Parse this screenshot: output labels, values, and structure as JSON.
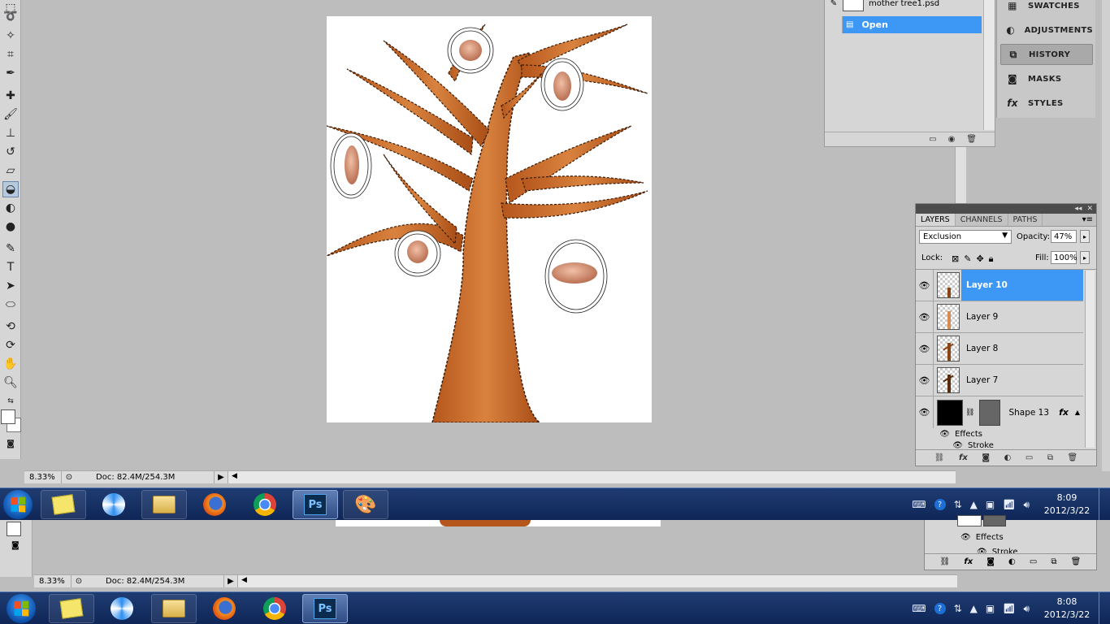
{
  "status_bar": {
    "zoom": "8.33%",
    "doc_info": "Doc: 82.4M/254.3M"
  },
  "status_bar_lower": {
    "zoom": "8.33%",
    "doc_info": "Doc: 82.4M/254.3M"
  },
  "history": {
    "snapshot_name": "mother tree1.psd",
    "items": [
      {
        "label": "Open",
        "selected": true
      }
    ]
  },
  "dock": {
    "items": [
      {
        "label": "SWATCHES",
        "icon": "swatches-icon"
      },
      {
        "label": "ADJUSTMENTS",
        "icon": "adjustments-icon"
      },
      {
        "label": "HISTORY",
        "icon": "history-icon",
        "active": true
      },
      {
        "label": "MASKS",
        "icon": "masks-icon"
      },
      {
        "label": "STYLES",
        "icon": "styles-icon"
      }
    ]
  },
  "layers_panel": {
    "tabs": [
      {
        "label": "LAYERS",
        "active": true
      },
      {
        "label": "CHANNELS"
      },
      {
        "label": "PATHS"
      }
    ],
    "blend_mode": "Exclusion",
    "opacity_label": "Opacity:",
    "opacity": "47%",
    "lock_label": "Lock:",
    "fill_label": "Fill:",
    "fill": "100%",
    "layers": [
      {
        "name": "Layer 10",
        "selected": true
      },
      {
        "name": "Layer 9"
      },
      {
        "name": "Layer 8"
      },
      {
        "name": "Layer 7"
      },
      {
        "name": "Shape 13",
        "fx": "fx"
      }
    ],
    "effects_label": "Effects",
    "stroke_label": "Stroke"
  },
  "lower_layers": {
    "effects_label": "Effects",
    "stroke_label": "Stroke"
  },
  "taskbar": {
    "time": "8:09",
    "date": "2012/3/22",
    "apps": [
      {
        "name": "sticky-notes",
        "icon": "sticky-notes-icon"
      },
      {
        "name": "media-center",
        "icon": "media-center-icon"
      },
      {
        "name": "explorer",
        "icon": "folder-icon"
      },
      {
        "name": "firefox",
        "icon": "firefox-icon"
      },
      {
        "name": "chrome",
        "icon": "chrome-icon"
      },
      {
        "name": "photoshop",
        "icon": "photoshop-icon",
        "label": "Ps"
      },
      {
        "name": "paint",
        "icon": "paint-palette-icon"
      }
    ]
  },
  "taskbar_lower": {
    "time": "8:08",
    "date": "2012/3/22",
    "photoshop_label": "Ps"
  },
  "colors": {
    "selection": "#3d98f5",
    "taskbar": "#1f3c72",
    "workspace": "#bdbdbd",
    "tree": "#c8692a"
  }
}
